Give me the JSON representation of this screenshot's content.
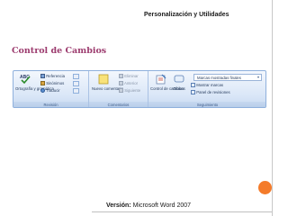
{
  "header": {
    "title": "Personalización y Utilidades"
  },
  "page": {
    "title": "Control de Cambios"
  },
  "ribbon": {
    "groups": [
      {
        "label": "Revisión",
        "buttons": [
          {
            "label": "Ortografía y gramática",
            "icon": "spell-check-icon"
          },
          {
            "label": "Referencia",
            "icon": "reference-icon"
          },
          {
            "label": "Sinónimos",
            "icon": "thesaurus-icon"
          },
          {
            "label": "Traducir",
            "icon": "translate-icon"
          }
        ]
      },
      {
        "label": "Comentarios",
        "buttons": [
          {
            "label": "Nuevo comentario",
            "icon": "new-comment-icon"
          },
          {
            "label": "Eliminar",
            "icon": "delete-comment-icon"
          },
          {
            "label": "Anterior",
            "icon": "previous-comment-icon"
          },
          {
            "label": "Siguiente",
            "icon": "next-comment-icon"
          }
        ]
      },
      {
        "label": "Seguimiento",
        "buttons": [
          {
            "label": "Control de cambios",
            "icon": "track-changes-icon"
          },
          {
            "label": "Globos",
            "icon": "balloons-icon"
          },
          {
            "label": "Mostrar marcas",
            "icon": "show-markup-icon"
          },
          {
            "label": "Panel de revisiones",
            "icon": "reviewing-pane-icon"
          }
        ],
        "display_for_review": "Marcas mostradas finales"
      }
    ]
  },
  "footer": {
    "version_label": "Versión:",
    "version_value": "Microsoft Word 2007"
  },
  "colors": {
    "title": "#9c3b6e",
    "accent_circle": "#f47b2a",
    "ribbon_border": "#8fb0dc"
  }
}
